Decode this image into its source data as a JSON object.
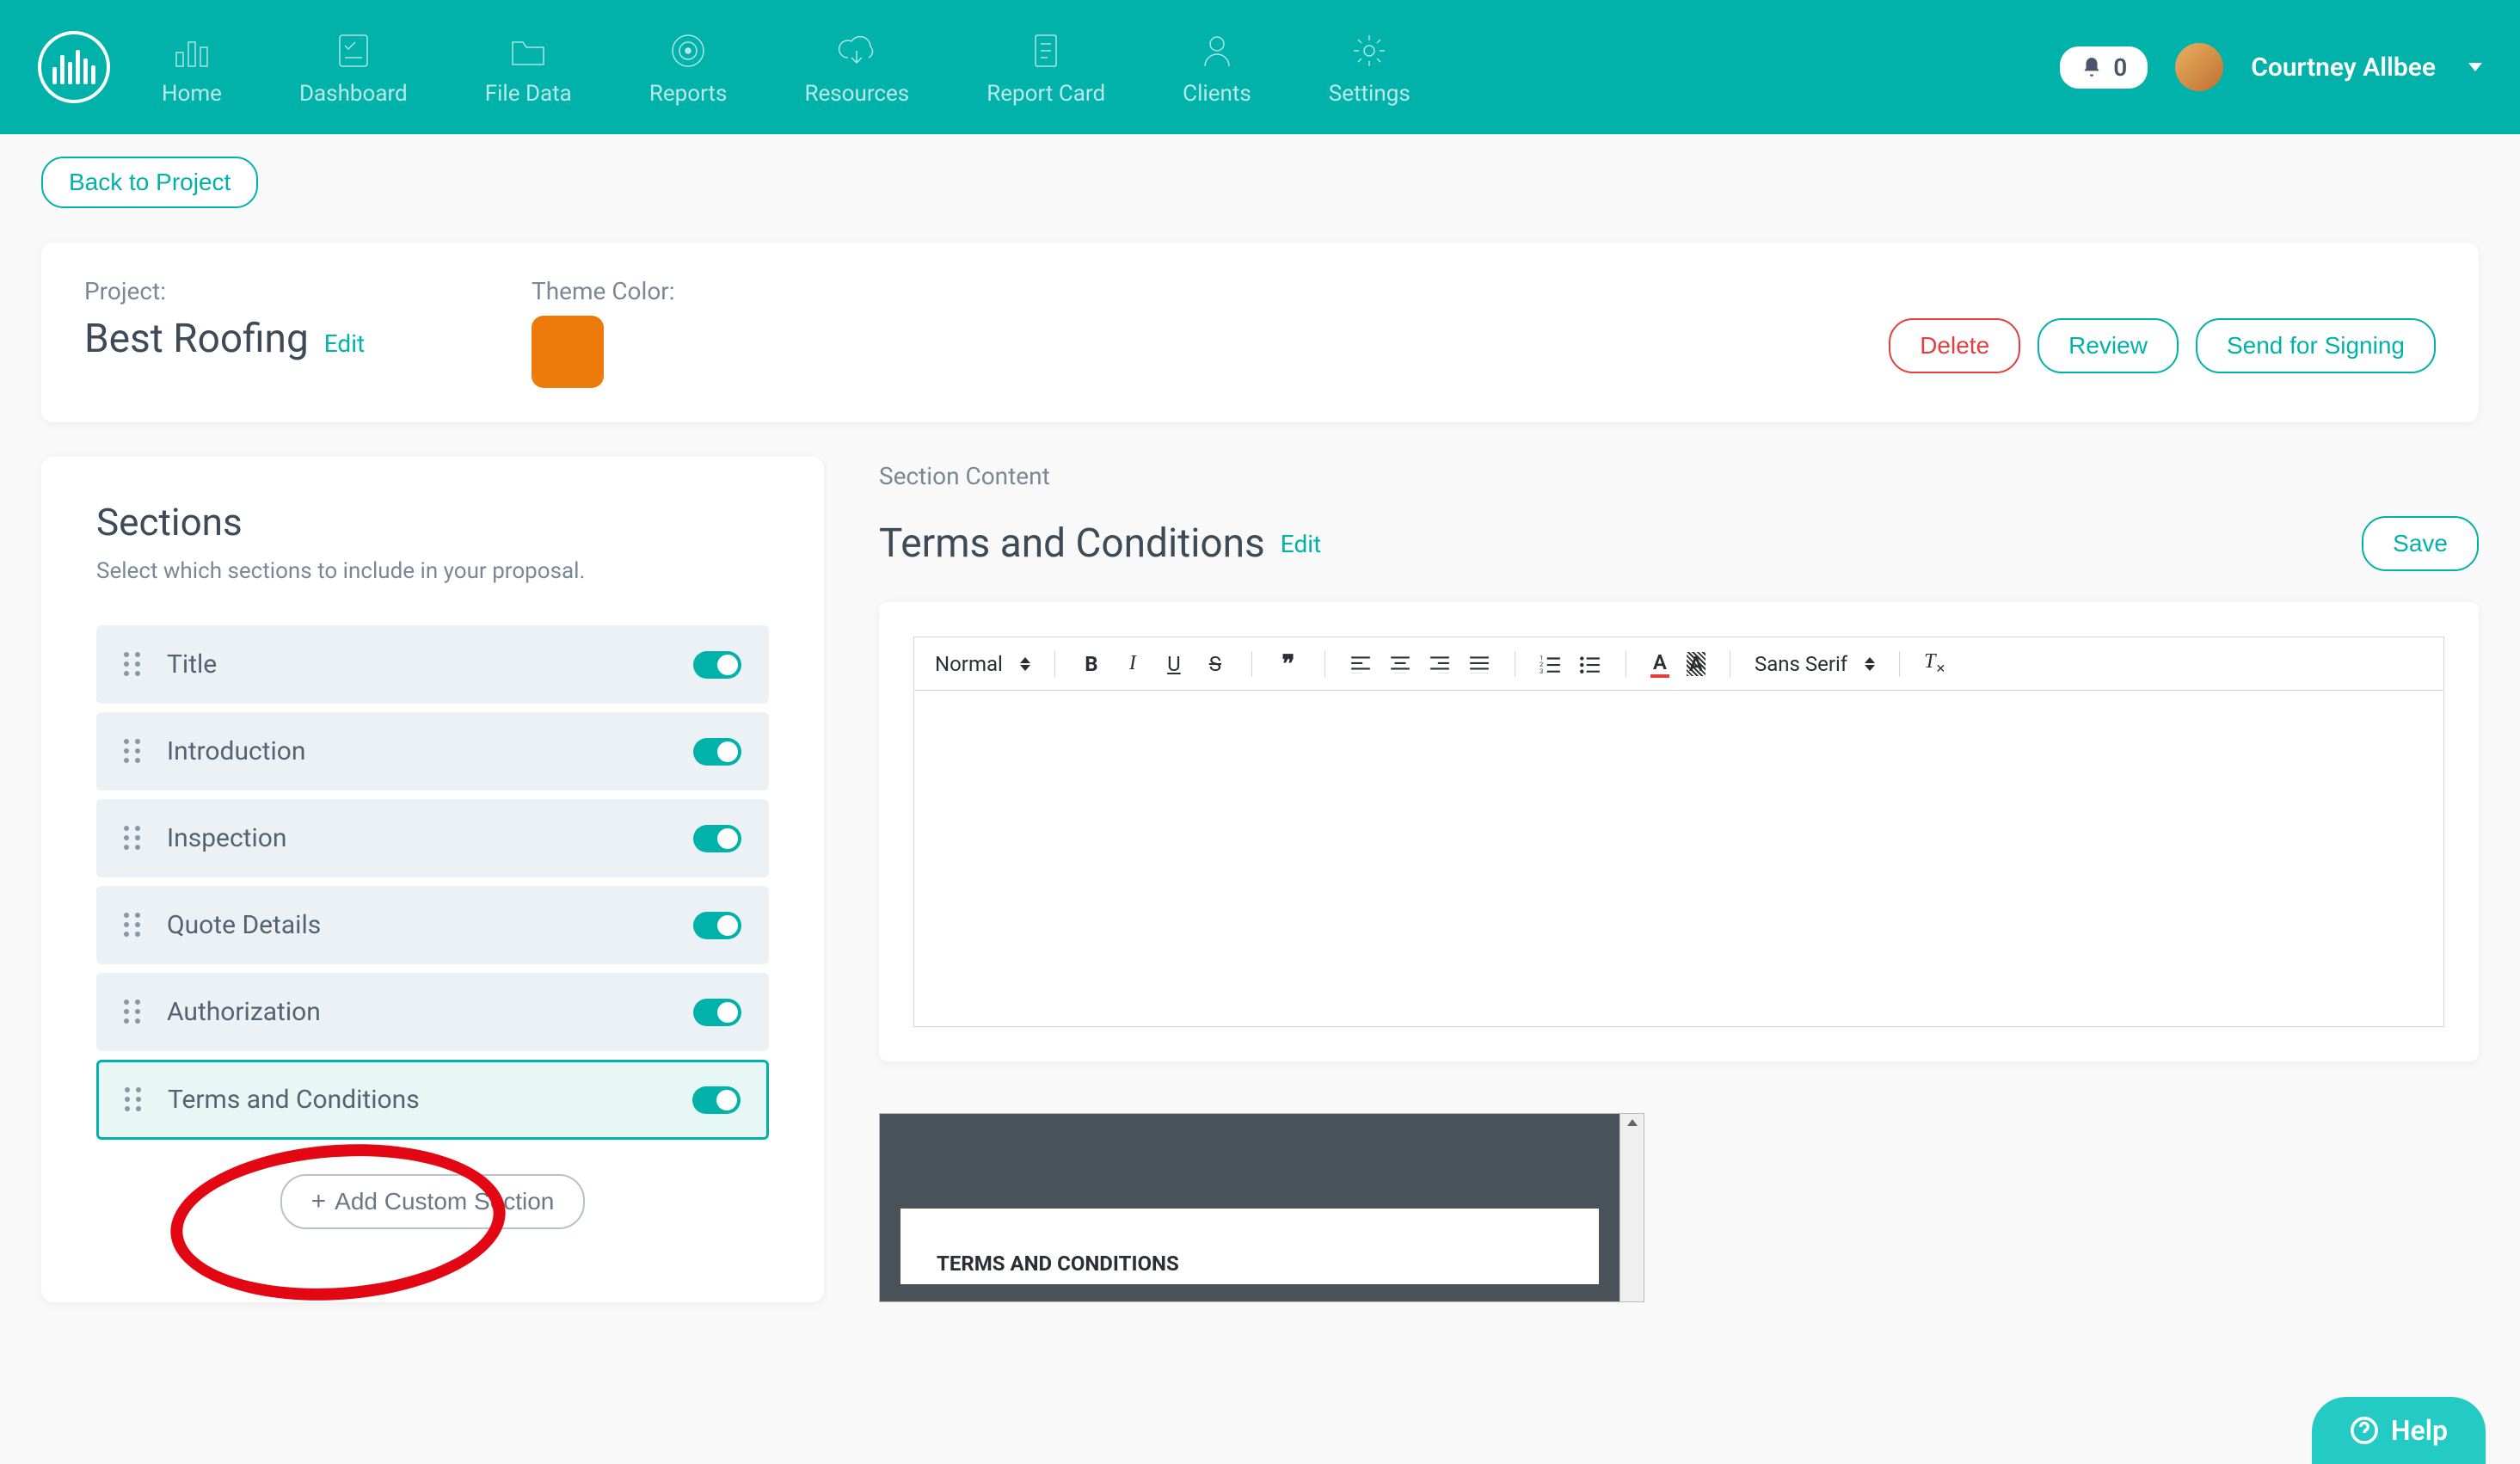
{
  "nav": {
    "items": [
      {
        "label": "Home"
      },
      {
        "label": "Dashboard"
      },
      {
        "label": "File Data"
      },
      {
        "label": "Reports"
      },
      {
        "label": "Resources"
      },
      {
        "label": "Report Card"
      },
      {
        "label": "Clients"
      },
      {
        "label": "Settings"
      }
    ],
    "notif_count": "0",
    "user_name": "Courtney Allbee"
  },
  "back_button": "Back to Project",
  "project": {
    "label": "Project:",
    "name": "Best Roofing",
    "edit": "Edit",
    "theme_label": "Theme Color:",
    "theme_color": "#ec7b0b",
    "actions": {
      "delete": "Delete",
      "review": "Review",
      "send": "Send for Signing"
    }
  },
  "sections_panel": {
    "title": "Sections",
    "subtitle": "Select which sections to include in your proposal.",
    "add_button": "Add Custom Section",
    "items": [
      {
        "label": "Title",
        "enabled": true,
        "active": false
      },
      {
        "label": "Introduction",
        "enabled": true,
        "active": false
      },
      {
        "label": "Inspection",
        "enabled": true,
        "active": false
      },
      {
        "label": "Quote Details",
        "enabled": true,
        "active": false
      },
      {
        "label": "Authorization",
        "enabled": true,
        "active": false
      },
      {
        "label": "Terms and Conditions",
        "enabled": true,
        "active": true
      }
    ]
  },
  "content_panel": {
    "label": "Section Content",
    "title": "Terms and Conditions",
    "edit": "Edit",
    "save": "Save",
    "toolbar": {
      "format": "Normal",
      "font": "Sans Serif"
    },
    "preview_heading": "TERMS AND CONDITIONS"
  },
  "help": "Help"
}
